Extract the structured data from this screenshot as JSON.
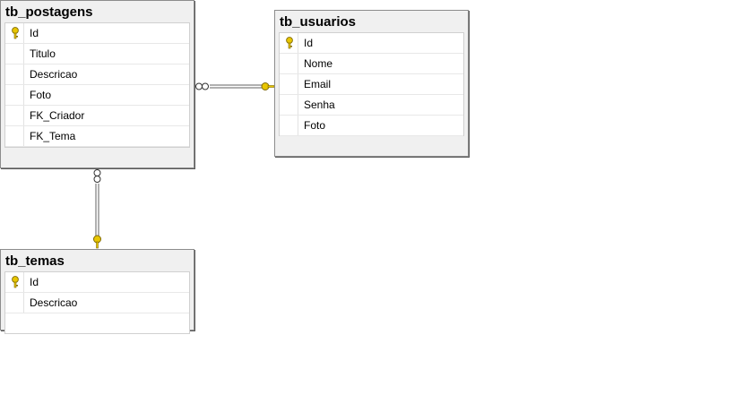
{
  "tables": {
    "postagens": {
      "title": "tb_postagens",
      "columns": [
        {
          "name": "Id",
          "key": true
        },
        {
          "name": "Titulo",
          "key": false
        },
        {
          "name": "Descricao",
          "key": false
        },
        {
          "name": "Foto",
          "key": false
        },
        {
          "name": "FK_Criador",
          "key": false
        },
        {
          "name": "FK_Tema",
          "key": false
        }
      ]
    },
    "usuarios": {
      "title": "tb_usuarios",
      "columns": [
        {
          "name": "Id",
          "key": true
        },
        {
          "name": "Nome",
          "key": false
        },
        {
          "name": "Email",
          "key": false
        },
        {
          "name": "Senha",
          "key": false
        },
        {
          "name": "Foto",
          "key": false
        }
      ]
    },
    "temas": {
      "title": "tb_temas",
      "columns": [
        {
          "name": "Id",
          "key": true
        },
        {
          "name": "Descricao",
          "key": false
        }
      ]
    }
  },
  "relationships": [
    {
      "from": "tb_postagens",
      "to": "tb_usuarios",
      "from_end": "many",
      "to_end": "one"
    },
    {
      "from": "tb_postagens",
      "to": "tb_temas",
      "from_end": "many",
      "to_end": "one"
    }
  ],
  "colors": {
    "key_icon": "#e8c600",
    "line": "#606060"
  }
}
